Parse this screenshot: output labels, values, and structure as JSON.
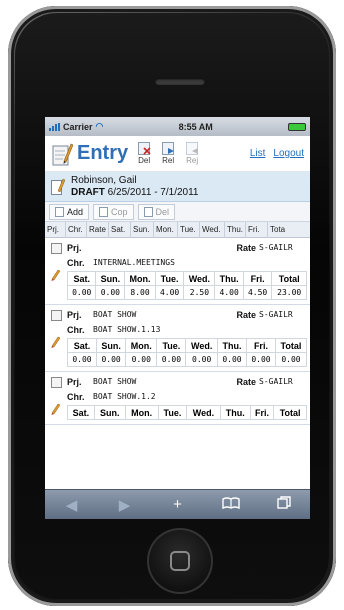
{
  "status": {
    "carrier": "Carrier",
    "time": "8:55 AM"
  },
  "header": {
    "title": "Entry",
    "tools": [
      {
        "label": "Del",
        "icon": "delete-doc-icon",
        "enabled": true
      },
      {
        "label": "Rel",
        "icon": "release-doc-icon",
        "enabled": true
      },
      {
        "label": "Rej",
        "icon": "reject-doc-icon",
        "enabled": false
      }
    ],
    "links": {
      "list": "List",
      "logout": "Logout"
    }
  },
  "info": {
    "name": "Robinson, Gail",
    "status": "DRAFT",
    "period": "6/25/2011 - 7/1/2011"
  },
  "actions": {
    "add": "Add",
    "copy": "Cop",
    "delete": "Del"
  },
  "columns": [
    "Prj.",
    "Chr.",
    "Rate",
    "Sat.",
    "Sun.",
    "Mon.",
    "Tue.",
    "Wed.",
    "Thu.",
    "Fri.",
    "Tota"
  ],
  "labels": {
    "prj": "Prj.",
    "chr": "Chr.",
    "rate": "Rate",
    "days": [
      "Sat.",
      "Sun.",
      "Mon.",
      "Tue.",
      "Wed.",
      "Thu.",
      "Fri.",
      "Total"
    ]
  },
  "entries": [
    {
      "project": "",
      "rate": "S-GAILR",
      "charge": "INTERNAL.MEETINGS",
      "hours": [
        "0.00",
        "0.00",
        "8.00",
        "4.00",
        "2.50",
        "4.00",
        "4.50",
        "23.00"
      ]
    },
    {
      "project": "BOAT SHOW",
      "rate": "S-GAILR",
      "charge": "BOAT SHOW.1.13",
      "hours": [
        "0.00",
        "0.00",
        "0.00",
        "0.00",
        "0.00",
        "0.00",
        "0.00",
        "0.00"
      ]
    },
    {
      "project": "BOAT SHOW",
      "rate": "S-GAILR",
      "charge": "BOAT SHOW.1.2",
      "hours": []
    }
  ],
  "colors": {
    "accent": "#2e6fb8",
    "infobar": "#dbe9f5",
    "toolbar": "#6f7e93"
  }
}
